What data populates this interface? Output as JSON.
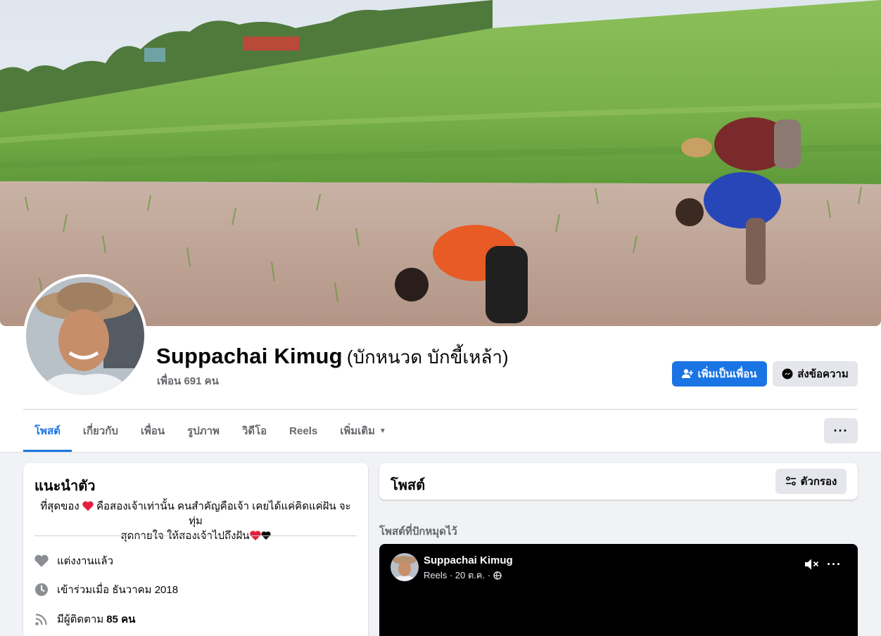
{
  "profile": {
    "name": "Suppachai Kimug",
    "alt_name": "(บักหนวด บักขี้เหล้า)",
    "friends": "เพื่อน 691 คน"
  },
  "actions": {
    "add_friend": "เพิ่มเป็นเพื่อน",
    "message": "ส่งข้อความ",
    "more": "···"
  },
  "tabs": [
    {
      "label": "โพสต์",
      "active": true
    },
    {
      "label": "เกี่ยวกับ"
    },
    {
      "label": "เพื่อน"
    },
    {
      "label": "รูปภาพ"
    },
    {
      "label": "วิดีโอ"
    },
    {
      "label": "Reels"
    },
    {
      "label": "เพิ่มเติม"
    }
  ],
  "intro": {
    "title": "แนะนำตัว",
    "bio_line1_a": "ที่สุดของ",
    "bio_line1_b": " คือสองเจ้าเท่านั้น คนสำคัญคือเจ้า เคยได้แค่คิดแค่ฝัน จะทุ่ม",
    "bio_line2": "สุดกายใจ ให้สองเจ้าไปถึงฝัน",
    "relationship": "แต่งงานแล้ว",
    "joined": "เข้าร่วมเมื่อ ธันวาคม 2018",
    "followers_prefix": "มีผู้ติดตาม",
    "followers_count": "85 คน"
  },
  "posts": {
    "title": "โพสต์",
    "filter": "ตัวกรอง",
    "pinned_label": "โพสต์ที่ปักหมุดไว้"
  },
  "reel": {
    "author": "Suppachai Kimug",
    "meta": "Reels · 20 ต.ค. ·"
  },
  "colors": {
    "accent": "#1b74e4",
    "background": "#f0f2f5",
    "secondary_button": "#e4e6eb",
    "muted_text": "#65676b",
    "heart": "#e41e3f"
  }
}
